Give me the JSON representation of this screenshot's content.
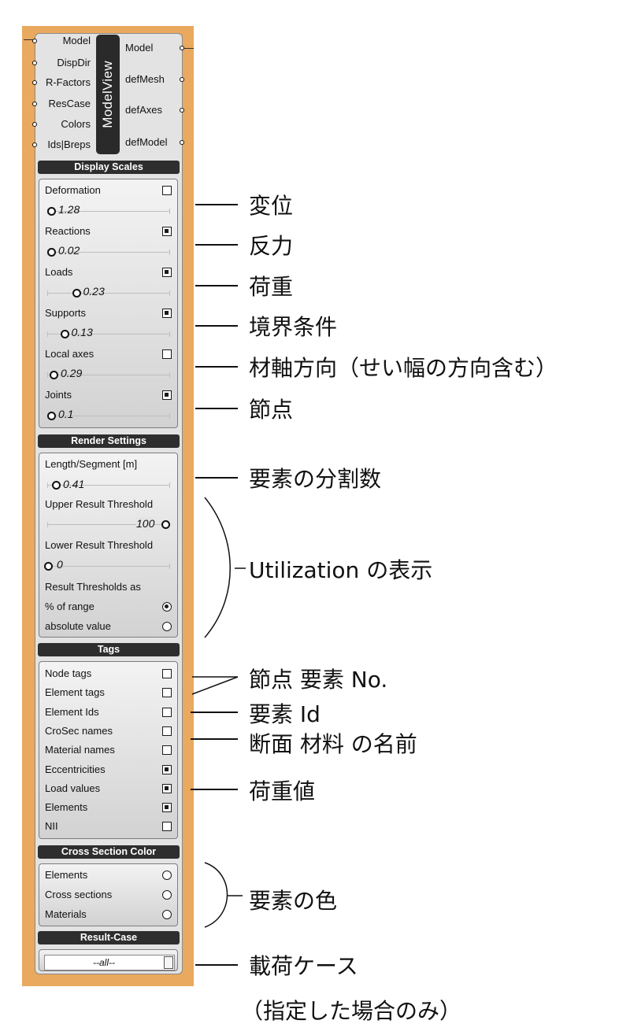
{
  "component": {
    "nickname": "ModelView",
    "inputs": [
      "Model",
      "DispDir",
      "R-Factors",
      "ResCase",
      "Colors",
      "Ids|Breps"
    ],
    "outputs": [
      "Model",
      "defMesh",
      "defAxes",
      "defModel"
    ]
  },
  "display_scales": {
    "header": "Display Scales",
    "items": [
      {
        "label": "Deformation",
        "checked": false,
        "value": "1.28",
        "pos": 0.02
      },
      {
        "label": "Reactions",
        "checked": true,
        "value": "0.02",
        "pos": 0.02
      },
      {
        "label": "Loads",
        "checked": true,
        "value": "0.23",
        "pos": 0.23
      },
      {
        "label": "Supports",
        "checked": true,
        "value": "0.13",
        "pos": 0.13
      },
      {
        "label": "Local axes",
        "checked": false,
        "value": "0.29",
        "pos": 0.04
      },
      {
        "label": "Joints",
        "checked": true,
        "value": "0.1",
        "pos": 0.02
      }
    ]
  },
  "render_settings": {
    "header": "Render Settings",
    "segment_label": "Length/Segment [m]",
    "segment_value": "0.41",
    "upper_label": "Upper Result Threshold",
    "upper_value": "100",
    "lower_label": "Lower Result Threshold",
    "lower_value": "0",
    "thresholds_label": "Result Thresholds as",
    "options": [
      {
        "label": "% of range",
        "selected": true
      },
      {
        "label": "absolute value",
        "selected": false
      }
    ]
  },
  "tags": {
    "header": "Tags",
    "items": [
      {
        "label": "Node tags",
        "checked": false
      },
      {
        "label": "Element tags",
        "checked": false
      },
      {
        "label": "Element Ids",
        "checked": false
      },
      {
        "label": "CroSec names",
        "checked": false
      },
      {
        "label": "Material names",
        "checked": false
      },
      {
        "label": "Eccentricities",
        "checked": true
      },
      {
        "label": "Load values",
        "checked": true
      },
      {
        "label": "Elements",
        "checked": true
      },
      {
        "label": "NII",
        "checked": false
      }
    ]
  },
  "cross_section_color": {
    "header": "Cross Section Color",
    "items": [
      {
        "label": "Elements",
        "selected": false
      },
      {
        "label": "Cross sections",
        "selected": false
      },
      {
        "label": "Materials",
        "selected": false
      }
    ]
  },
  "result_case": {
    "header": "Result-Case",
    "value": "--all--"
  },
  "annotations": {
    "deformation": "変位",
    "reactions": "反力",
    "loads": "荷重",
    "supports": "境界条件",
    "local_axes": "材軸方向（せい幅の方向含む）",
    "joints": "節点",
    "segments": "要素の分割数",
    "utilization": "Utilization の表示",
    "node_element_tags": "節点 要素 No.",
    "element_ids": "要素 Id",
    "names": "断面 材料 の名前",
    "load_values": "荷重値",
    "element_colors": "要素の色",
    "load_case": "載荷ケース",
    "load_case_note": "（指定した場合のみ）"
  },
  "colors": {
    "canvas": "#e9a95e",
    "panel": "#e3e3e3",
    "header": "#2e2e2e"
  }
}
